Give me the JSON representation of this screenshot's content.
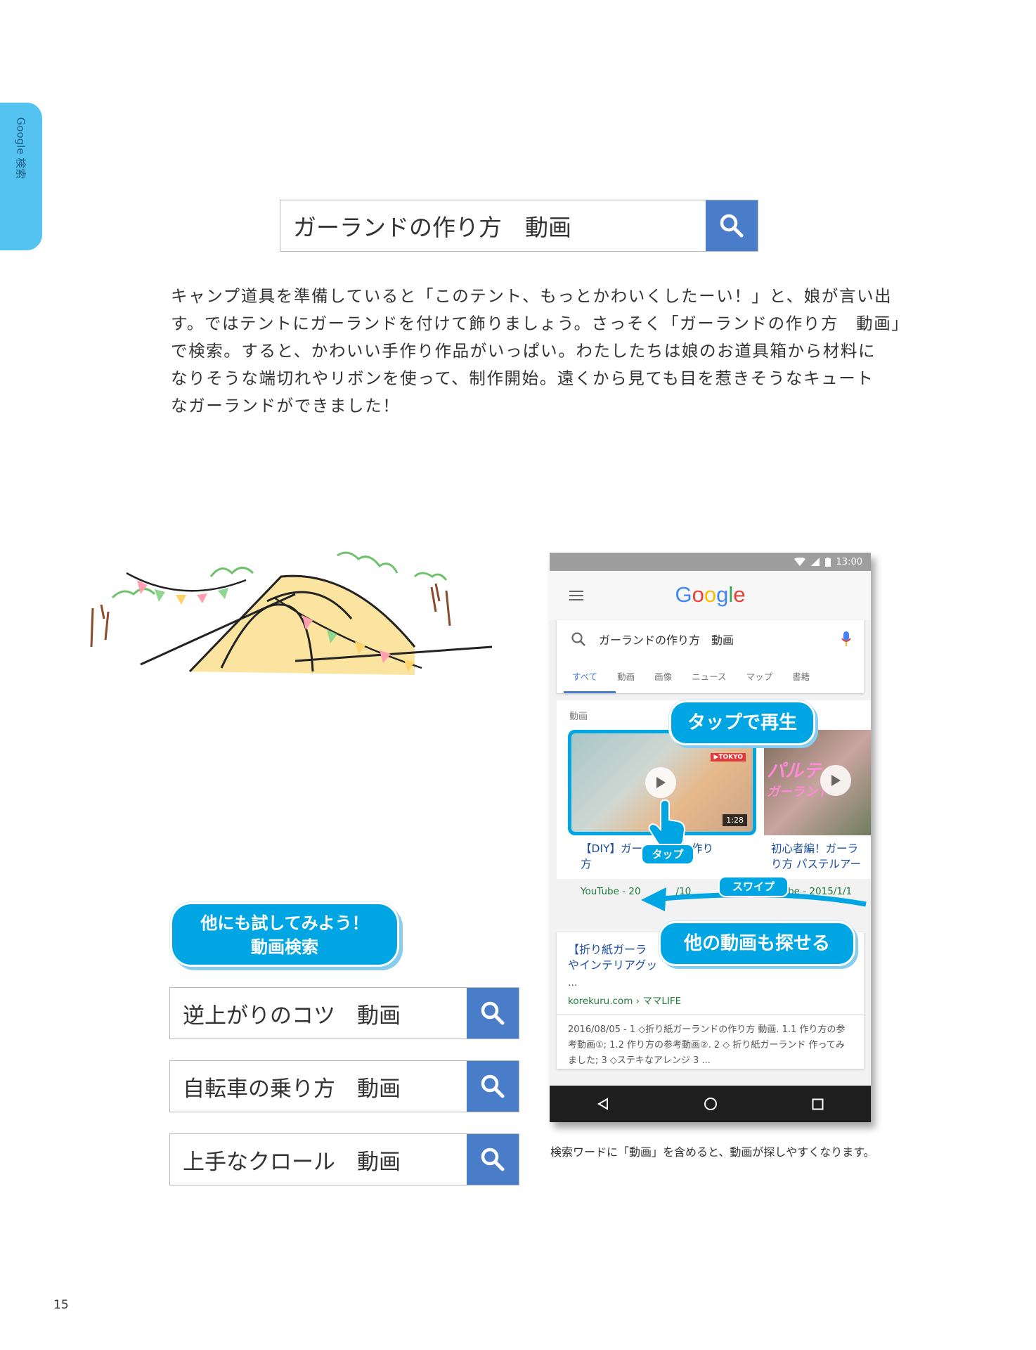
{
  "side_tab": {
    "label": "Google 検索"
  },
  "main_search": {
    "query": "ガーランドの作り方　動画"
  },
  "body_paragraph": [
    "キャンプ道具を準備していると「このテント、もっとかわいくしたーい！」と、娘が言い出",
    "す。ではテントにガーランドを付けて飾りましょう。さっそく「ガーランドの作り方　動画」",
    "で検索。すると、かわいい手作り作品がいっぱい。わたしたちは娘のお道具箱から材料に",
    "なりそうな端切れやリボンを使って、制作開始。遠くから見ても目を惹きそうなキュート",
    "なガーランドができました！"
  ],
  "try_bubble": {
    "line1": "他にも試してみよう！",
    "line2": "動画検索"
  },
  "example_searches": [
    {
      "query": "逆上がりのコツ　動画"
    },
    {
      "query": "自転車の乗り方　動画"
    },
    {
      "query": "上手なクロール　動画"
    }
  ],
  "phone": {
    "status_time": "13:00",
    "logo": "Google",
    "search_query": "ガーランドの作り方　動画",
    "tabs": [
      {
        "label": "すべて"
      },
      {
        "label": "動画"
      },
      {
        "label": "画像"
      },
      {
        "label": "ニュース"
      },
      {
        "label": "マップ"
      },
      {
        "label": "書籍"
      }
    ],
    "videos_label": "動画",
    "video1": {
      "duration": "1:28",
      "title_line1": "【DIY】ガー",
      "title_suffix": "作り",
      "title_line2": "方",
      "source": "YouTube - 20",
      "source_tail": "/10",
      "thumb_text": "▶TOKYO"
    },
    "video2": {
      "thumb_text_line1": "パルテ",
      "thumb_text_line2": "ガーランド",
      "title_line1": "初心者編！ガーラ",
      "title_line2": "り方 パステルアー",
      "source": "rube - 2015/1/1"
    },
    "result": {
      "title_line1": "【折り紙ガーラ",
      "title_line2": "やインテリアグッ",
      "dots": "...",
      "url": "korekuru.com › ママLIFE",
      "snippet": "2016/08/05 - 1 ◇折り紙ガーランドの作り方 動画. 1.1 作り方の参考動画①; 1.2 作り方の参考動画②. 2 ◇ 折り紙ガーランド 作ってみました; 3 ◇ステキなアレンジ 3 ..."
    },
    "callouts": {
      "tap_to_play": "タップで再生",
      "tap": "タップ",
      "swipe": "スワイプ",
      "find_more": "他の動画も探せる"
    }
  },
  "caption": "検索ワードに「動画」を含めると、動画が探しやすくなります。",
  "page_number": "15",
  "colors": {
    "accent_blue": "#00a5e3",
    "search_button": "#4a7dc9",
    "side_tab": "#54c3f1"
  }
}
